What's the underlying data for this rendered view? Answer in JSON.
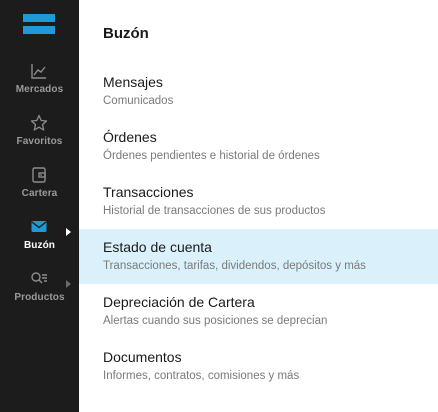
{
  "sidebar": {
    "items": [
      {
        "label": "Mercados",
        "icon": "chart-line-icon"
      },
      {
        "label": "Favoritos",
        "icon": "star-icon"
      },
      {
        "label": "Cartera",
        "icon": "wallet-icon"
      },
      {
        "label": "Buzón",
        "icon": "mail-icon",
        "active": true
      },
      {
        "label": "Productos",
        "icon": "search-list-icon"
      }
    ]
  },
  "main": {
    "title": "Buzón",
    "items": [
      {
        "title": "Mensajes",
        "subtitle": "Comunicados"
      },
      {
        "title": "Órdenes",
        "subtitle": "Órdenes pendientes e historial de órdenes"
      },
      {
        "title": "Transacciones",
        "subtitle": "Historial de transacciones de sus productos"
      },
      {
        "title": "Estado de cuenta",
        "subtitle": "Transacciones, tarifas, dividendos, depósitos y más",
        "highlighted": true
      },
      {
        "title": "Depreciación de Cartera",
        "subtitle": "Alertas cuando sus posiciones se deprecian"
      },
      {
        "title": "Documentos",
        "subtitle": "Informes, contratos, comisiones y más"
      }
    ]
  },
  "colors": {
    "sidebar_bg": "#1c1c1c",
    "accent": "#1f9ad6",
    "highlight_bg": "#daf1fb"
  }
}
